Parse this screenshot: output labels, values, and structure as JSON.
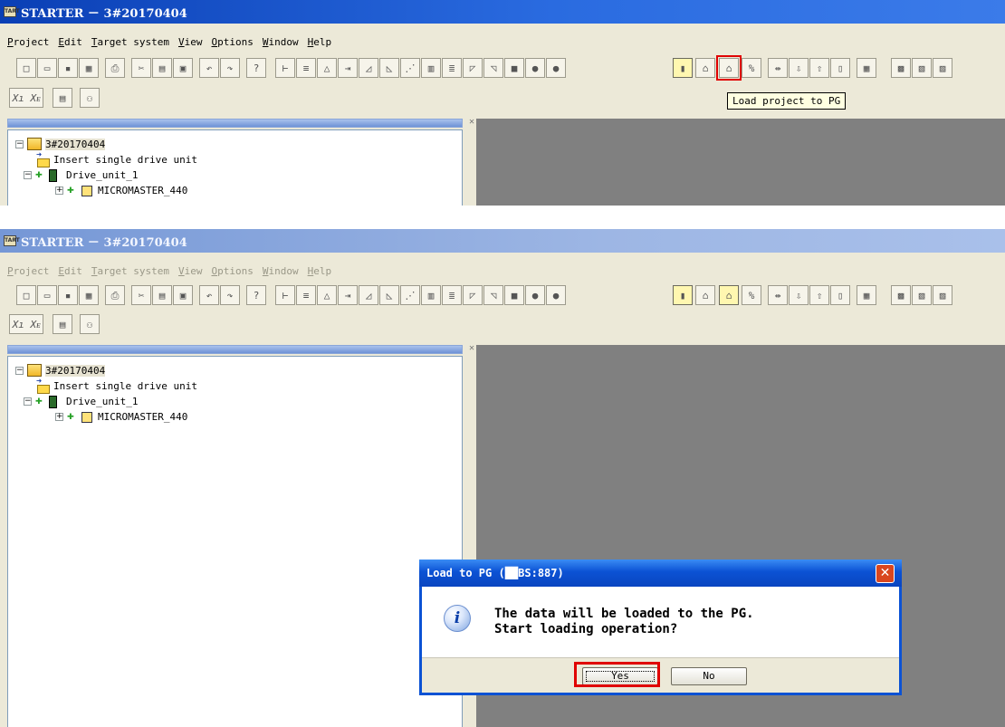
{
  "app": {
    "title": "STARTER － 3#20170404",
    "icon_label": "TART"
  },
  "menu": [
    "Project",
    "Edit",
    "Target system",
    "View",
    "Options",
    "Window",
    "Help"
  ],
  "toolbar": {
    "tooltip": "Load project to PG",
    "icons": [
      "new-icon",
      "open-icon",
      "save-icon",
      "save-compile-icon",
      "print-icon",
      "cut-icon",
      "copy-icon",
      "paste-icon",
      "undo-icon",
      "redo-icon",
      "help-pointer-icon",
      "load-to-pg-icon"
    ]
  },
  "tree": {
    "project": "3#20170404",
    "insert": "Insert single drive unit",
    "drive": "Drive_unit_1",
    "device": "MICROMASTER_440"
  },
  "dialog": {
    "title": "Load to PG (██BS:887)",
    "line1": "The data will be loaded to the PG.",
    "line2": "Start loading operation?",
    "yes": "Yes",
    "no": "No",
    "close": "✕"
  },
  "colors": {
    "highlight": "#e00000",
    "workspace": "#808080",
    "title_active": "#0a3fb5",
    "title_inactive": "#7597d6"
  }
}
